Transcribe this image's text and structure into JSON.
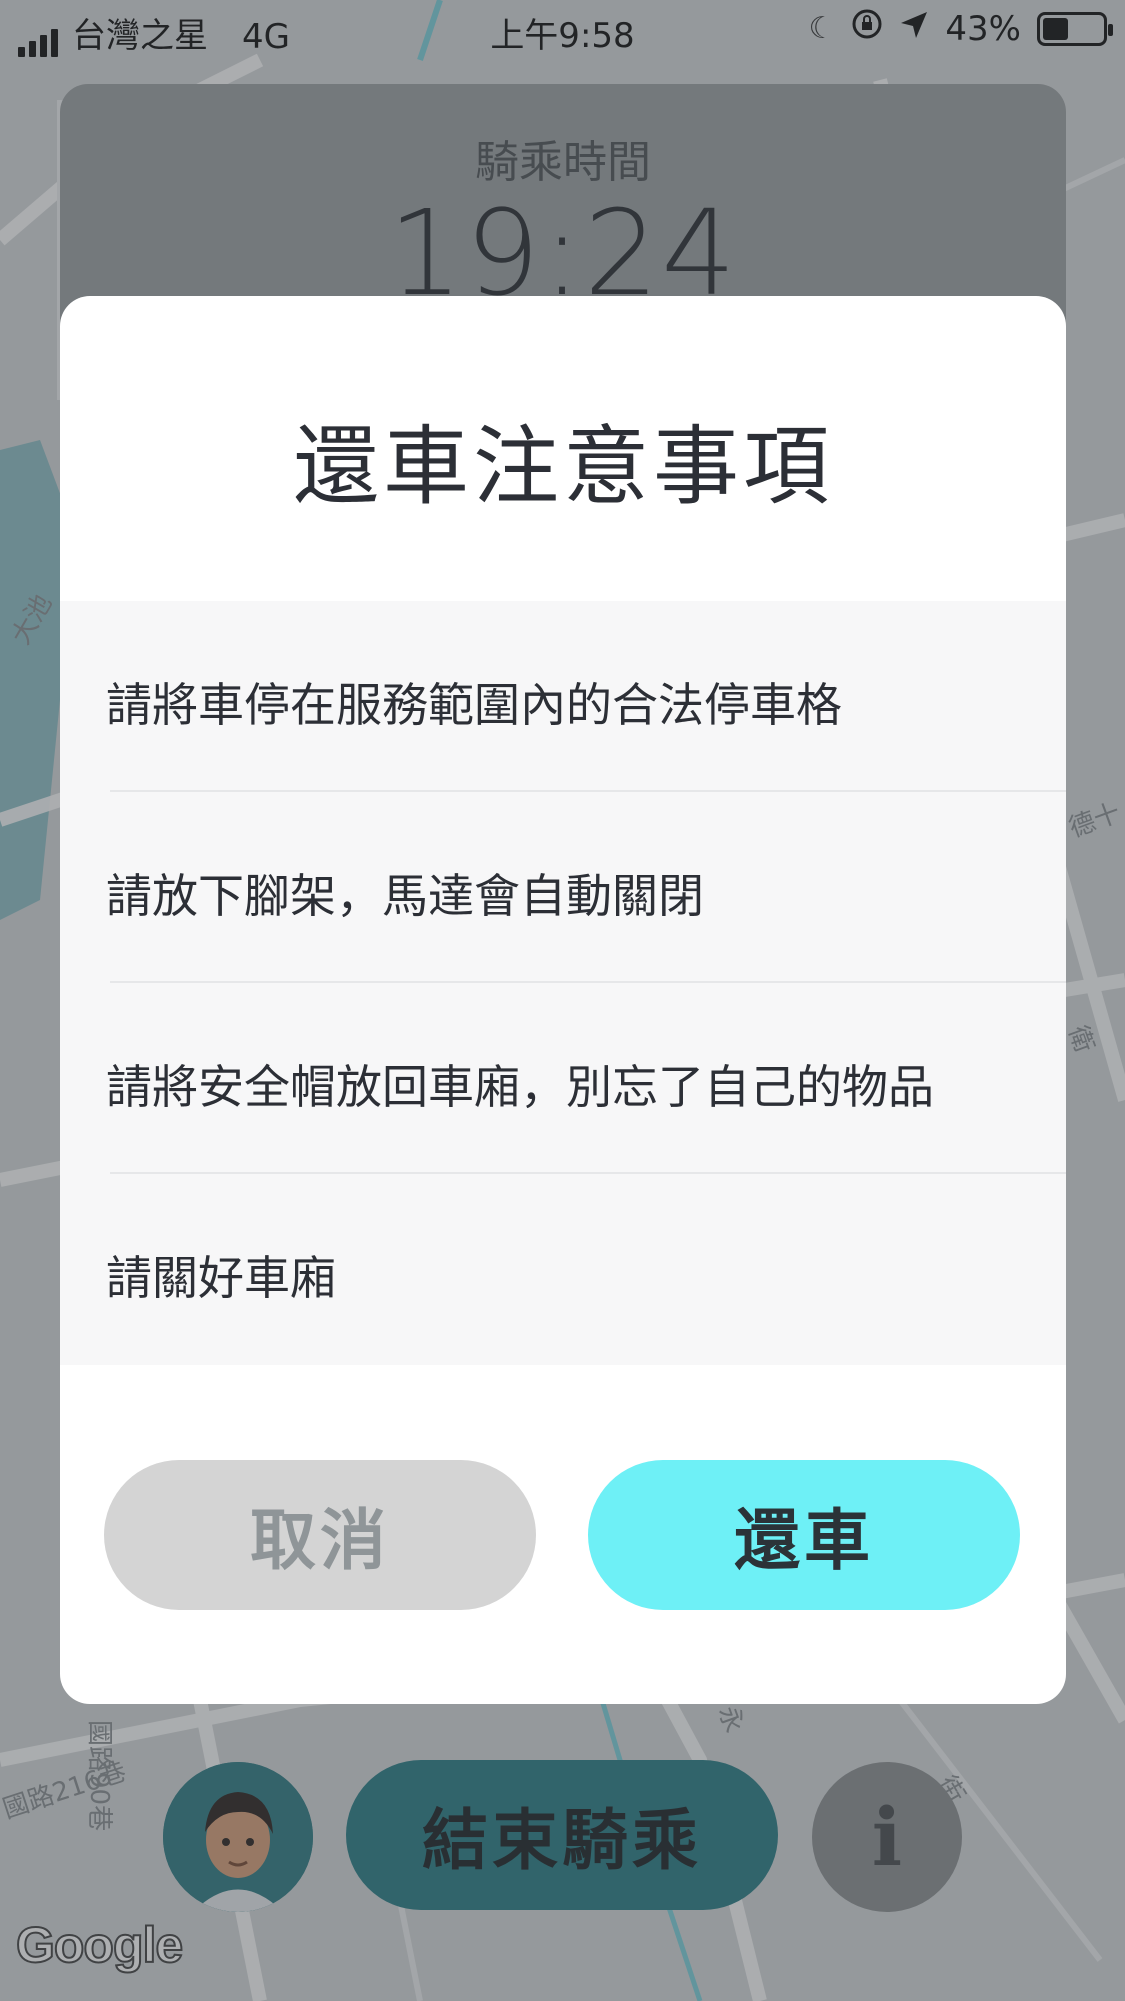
{
  "status_bar": {
    "carrier": "台灣之星",
    "network": "4G",
    "time": "上午9:58",
    "battery": "43%",
    "battery_level": 0.43
  },
  "map": {
    "labels": [
      "國路216巷",
      "國路90巷",
      "德十",
      "街",
      "衛",
      "永",
      "大池"
    ],
    "provider": "Google"
  },
  "ride_card": {
    "label": "騎乘時間",
    "time": "19:24"
  },
  "modal": {
    "title": "還車注意事項",
    "notices": [
      "請將車停在服務範圍內的合法停車格",
      "請放下腳架，馬達會自動關閉",
      "請將安全帽放回車廂，別忘了自己的物品",
      "請關好車廂"
    ],
    "cancel_label": "取消",
    "confirm_label": "還車"
  },
  "bottom_bar": {
    "end_ride_label": "結束騎乘",
    "info_label": "i"
  },
  "colors": {
    "accent": "#6ef0f6",
    "end_ride": "#2a7f87",
    "cancel": "#d4d4d4"
  }
}
